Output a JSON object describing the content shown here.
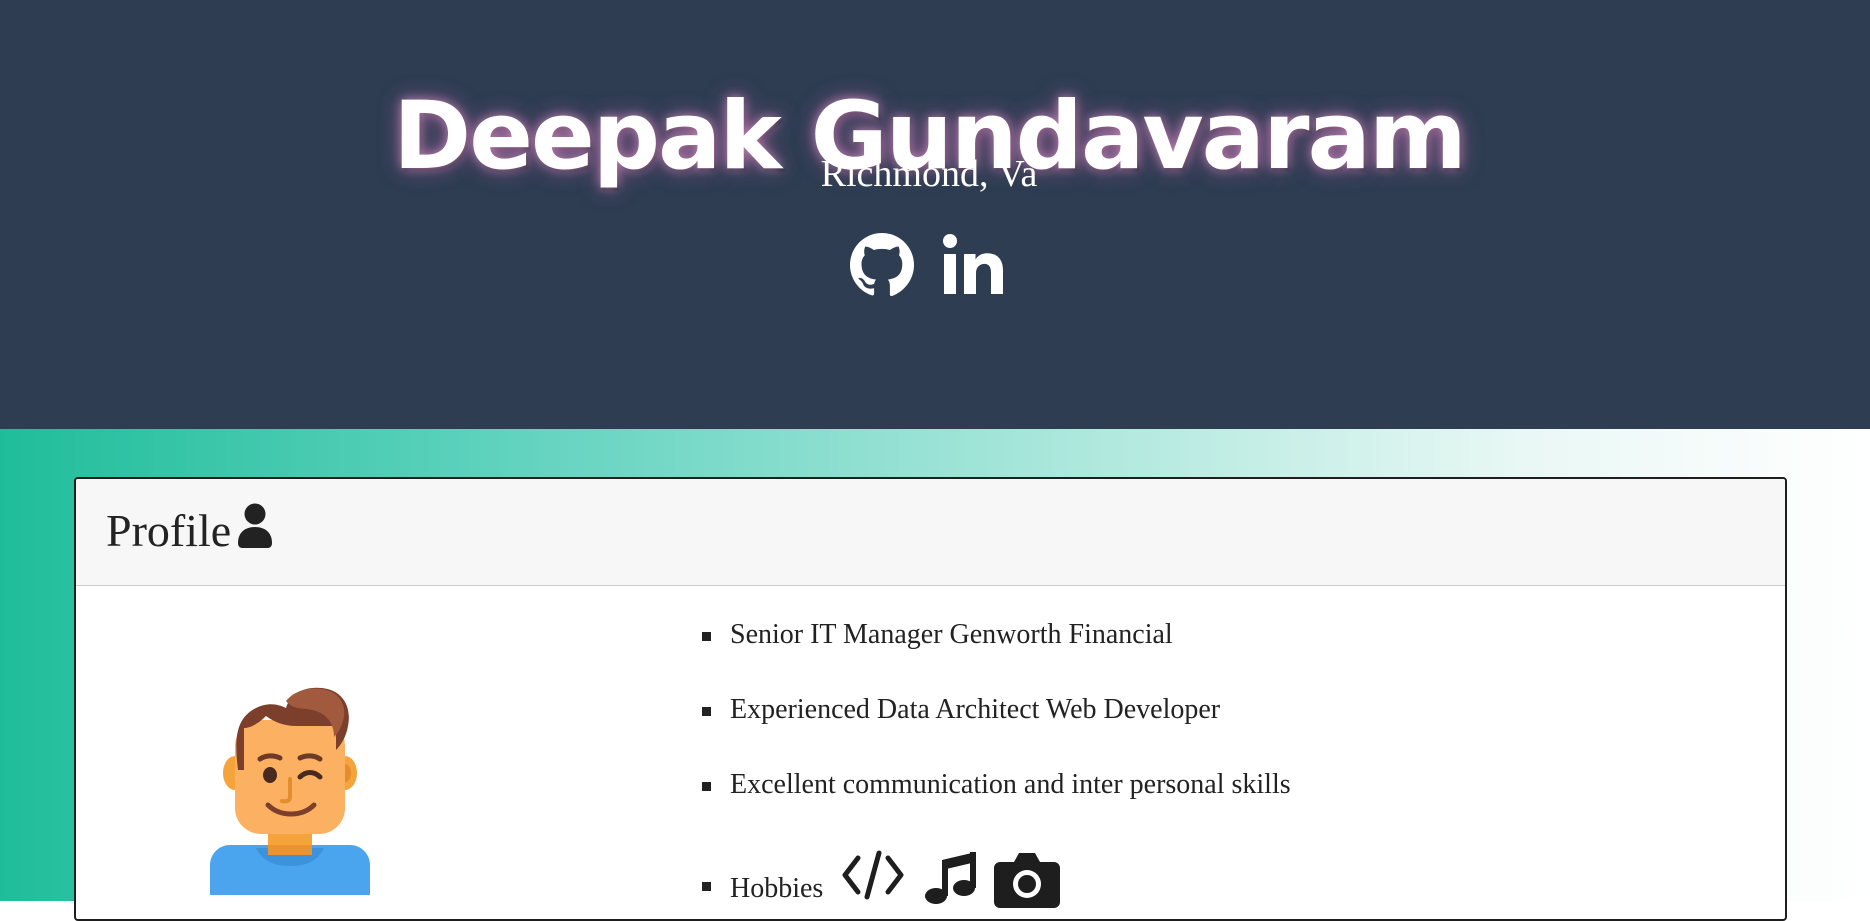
{
  "header": {
    "name": "Deepak Gundavaram",
    "location": "Richmond, Va",
    "social_links": [
      {
        "icon": "github-icon"
      },
      {
        "icon": "linkedin-icon"
      }
    ]
  },
  "profile": {
    "title": "Profile",
    "title_icon": "user-icon",
    "avatar_icon": "avatar-winking-man-icon",
    "facts": [
      "Senior IT Manager Genworth Financial",
      "Experienced Data Architect Web Developer",
      "Excellent communication and inter personal skills"
    ],
    "hobbies_label": "Hobbies",
    "hobby_icons": [
      "code-icon",
      "music-note-icon",
      "camera-icon"
    ]
  },
  "colors": {
    "header_bg": "#2e3d52",
    "band_gradient_start": "#20bd9b",
    "band_gradient_end": "#ffffff",
    "card_header_bg": "#f7f7f7",
    "text_dark": "#222222"
  }
}
